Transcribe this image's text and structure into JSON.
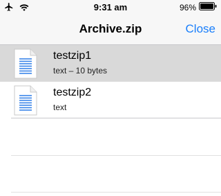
{
  "status": {
    "time": "9:31 am",
    "battery": "96%"
  },
  "nav": {
    "title": "Archive.zip",
    "close_label": "Close"
  },
  "files": [
    {
      "name": "testzip1",
      "detail": "text – 10 bytes",
      "selected": true
    },
    {
      "name": "testzip2",
      "detail": "text",
      "selected": false
    }
  ],
  "icons": {
    "airplane": "airplane-icon",
    "wifi": "wifi-icon",
    "battery": "battery-icon",
    "document": "document-icon"
  },
  "colors": {
    "accent": "#1a7ffb",
    "selected_row": "#d9d9d9",
    "doc_lines": "#2f7ee8"
  }
}
